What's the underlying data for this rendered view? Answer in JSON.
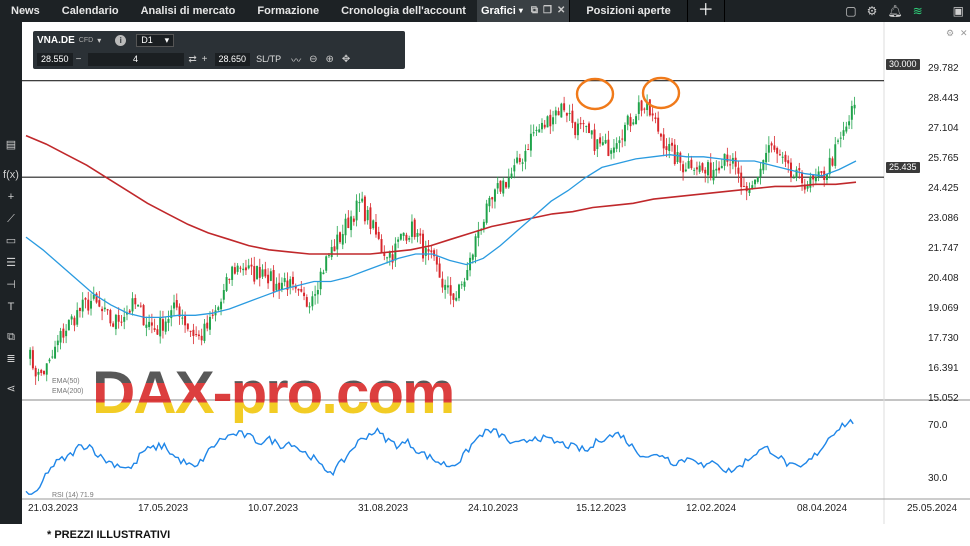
{
  "topnav": {
    "items": [
      "News",
      "Calendario",
      "Analisi di mercato",
      "Formazione",
      "Cronologia dell'account"
    ],
    "active_tab": "Grafici",
    "next_tab": "Posizioni aperte"
  },
  "symbol_bar": {
    "symbol": "VNA.DE",
    "type": "CFD",
    "timeframe": "D1",
    "sell_price": "28.550",
    "quantity": "4",
    "buy_price": "28.650",
    "sltp_label": "SL/TP"
  },
  "price_axis": [
    "29.782",
    "28.443",
    "27.104",
    "25.765",
    "24.425",
    "23.086",
    "21.747",
    "20.408",
    "19.069",
    "17.730",
    "16.391",
    "15.052"
  ],
  "rsi_axis": [
    "70.0",
    "30.0"
  ],
  "date_axis": [
    "21.03.2023",
    "17.05.2023",
    "10.07.2023",
    "31.08.2023",
    "24.10.2023",
    "15.12.2023",
    "12.02.2024",
    "08.04.2024",
    "25.05.2024"
  ],
  "hlines": {
    "top": "30.000",
    "middle": "25.435"
  },
  "indicators": {
    "ema1": "EMA(50)",
    "ema2": "EMA(200)",
    "rsi": "RSI (14) 71.9"
  },
  "watermark": "DAX-pro.com",
  "footer": "* PREZZI ILLUSTRATIVI",
  "colors": {
    "up": "#1fa34a",
    "down": "#d8262b",
    "ema_fast": "#2a9be0",
    "ema_slow": "#c0282b",
    "rsi": "#1f86e8",
    "marker": "#f07a1a"
  },
  "chart_data": {
    "type": "candlestick",
    "ylim": [
      14.8,
      30.6
    ],
    "x_dates": [
      "21.03.2023",
      "17.05.2023",
      "10.07.2023",
      "31.08.2023",
      "24.10.2023",
      "15.12.2023",
      "12.02.2024",
      "08.04.2024",
      "25.05.2024"
    ],
    "close_path": [
      17.2,
      16.0,
      16.5,
      17.8,
      18.6,
      19.2,
      19.6,
      19.0,
      18.5,
      19.0,
      19.4,
      18.7,
      18.2,
      18.8,
      19.3,
      18.3,
      17.8,
      18.5,
      19.5,
      21.0,
      21.3,
      20.8,
      21.2,
      20.2,
      20.6,
      19.8,
      19.5,
      20.5,
      21.7,
      22.5,
      23.5,
      24.2,
      23.2,
      22.0,
      21.8,
      22.8,
      23.0,
      21.8,
      21.2,
      20.0,
      19.8,
      21.0,
      23.0,
      24.0,
      25.0,
      25.5,
      26.3,
      27.5,
      27.8,
      28.5,
      28.8,
      27.8,
      27.5,
      27.0,
      26.8,
      27.5,
      28.0,
      28.9,
      28.4,
      27.4,
      26.5,
      26.0,
      26.2,
      25.6,
      25.9,
      26.7,
      25.6,
      24.3,
      25.6,
      26.9,
      26.3,
      25.5,
      25.3,
      25.1,
      25.4,
      26.4,
      27.5,
      28.8
    ],
    "ema_fast": [
      22.6,
      22.0,
      21.3,
      20.6,
      19.9,
      19.4,
      19.0,
      18.8,
      18.8,
      18.9,
      18.9,
      19.0,
      19.2,
      19.5,
      19.8,
      20.1,
      20.3,
      20.5,
      20.5,
      20.7,
      21.0,
      21.3,
      21.6,
      21.8,
      21.8,
      21.5,
      21.3,
      21.6,
      22.2,
      22.9,
      23.6,
      24.3,
      24.8,
      25.4,
      25.9,
      26.1,
      26.3,
      26.4,
      26.5,
      26.4,
      26.4,
      26.3,
      26.2,
      26.2,
      26.0,
      25.8,
      25.6,
      25.5,
      25.8,
      26.2
    ],
    "ema_slow": [
      27.4,
      27.0,
      26.5,
      26.0,
      25.4,
      24.8,
      24.2,
      23.7,
      23.2,
      22.8,
      22.5,
      22.2,
      22.0,
      21.9,
      21.8,
      21.8,
      21.8,
      21.8,
      21.9,
      22.0,
      22.2,
      22.5,
      22.8,
      23.1,
      23.3,
      23.5,
      23.7,
      23.8,
      24.0,
      24.1,
      24.2,
      24.4,
      24.5,
      24.6,
      24.7,
      24.8,
      24.9,
      25.0,
      25.0,
      25.1,
      25.1,
      25.2
    ],
    "rsi": [
      24,
      22,
      38,
      45,
      48,
      55,
      56,
      48,
      44,
      42,
      40,
      52,
      54,
      56,
      48,
      44,
      40,
      50,
      58,
      62,
      64,
      62,
      58,
      60,
      56,
      58,
      52,
      48,
      40,
      38,
      46,
      56,
      62,
      66,
      60,
      56,
      58,
      52,
      48,
      44,
      42,
      46,
      56,
      64,
      66,
      62,
      56,
      58,
      62,
      60,
      58,
      56,
      54,
      52,
      60,
      62,
      64,
      56,
      50,
      48,
      50,
      44,
      46,
      48,
      40,
      46,
      38,
      40,
      46,
      52,
      54,
      48,
      42,
      40,
      46,
      54,
      64,
      70,
      72
    ]
  }
}
